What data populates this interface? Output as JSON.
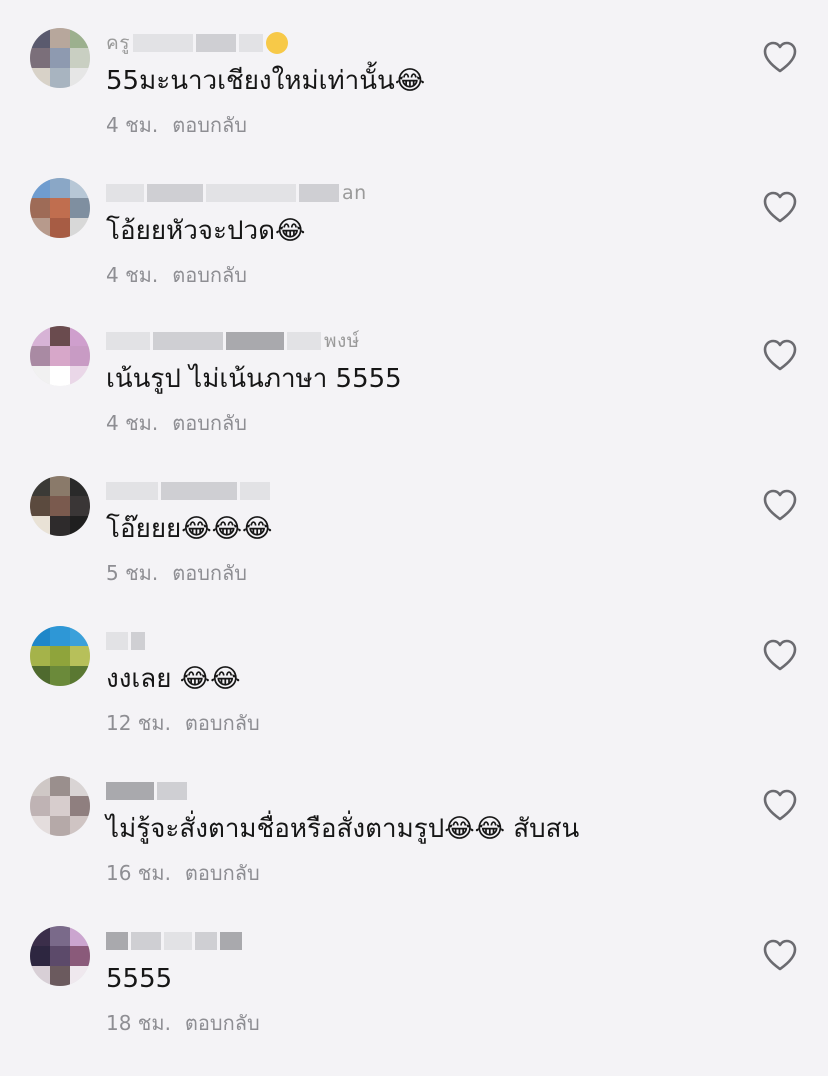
{
  "comments": [
    {
      "username": "ครู",
      "text": "55มะนาวเชียงใหม่เท่านั้น😂",
      "time": "4 ชม.",
      "reply": "ตอบกลับ",
      "avatar_colors": [
        "#5a5a6e",
        "#b7a79c",
        "#9cb08e",
        "#7b6f7a",
        "#8e9ab0",
        "#c9cfc2",
        "#d8d2c8",
        "#a8b4c0",
        "#e6e6e6"
      ]
    },
    {
      "username": "an",
      "text": "โอ้ยยหัวจะปวด😂",
      "time": "4 ชม.",
      "reply": "ตอบกลับ",
      "avatar_colors": [
        "#6f9ccf",
        "#8aa7c6",
        "#b7c7d6",
        "#9e6b57",
        "#c06e4f",
        "#7f8fa0",
        "#b79a8c",
        "#a75c44",
        "#d8d8d8"
      ]
    },
    {
      "username": "พงษ์",
      "text": "เน้นรูป ไม่เน้นภาษา 5555",
      "time": "4 ชม.",
      "reply": "ตอบกลับ",
      "avatar_colors": [
        "#d7b3d6",
        "#6a4b4e",
        "#cf9fcd",
        "#a98aa3",
        "#d7a7c9",
        "#c89bc4",
        "#f1f1f1",
        "#ffffff",
        "#ead7e8"
      ]
    },
    {
      "username": "",
      "text": "โอ๊ยยย😂😂😂",
      "time": "5 ชม.",
      "reply": "ตอบกลับ",
      "avatar_colors": [
        "#3b3a36",
        "#8a7a6a",
        "#2a2a2a",
        "#5b4a3e",
        "#7a5a4e",
        "#3a3636",
        "#e9e2d6",
        "#2e2b2c",
        "#1f1f1f"
      ]
    },
    {
      "username": "",
      "text": "งงเลย 😂😂",
      "time": "12 ชม.",
      "reply": "ตอบกลับ",
      "avatar_colors": [
        "#1f87c9",
        "#2e97d6",
        "#3ba0da",
        "#a5b34a",
        "#8fa43b",
        "#b7c05a",
        "#4f6a2e",
        "#6b8a3a",
        "#5a7832"
      ]
    },
    {
      "username": "",
      "text": "ไม่รู้จะสั่งตามชื่อหรือสั่งตามรูป😂😂 สับสน",
      "time": "16 ชม.",
      "reply": "ตอบกลับ",
      "avatar_colors": [
        "#cfc8c6",
        "#9a8f8d",
        "#d9d4d4",
        "#bfb3b4",
        "#d7cdcd",
        "#8f7f7f",
        "#e4dddd",
        "#b5a9a8",
        "#cfc4c3"
      ]
    },
    {
      "username": "",
      "text": "5555",
      "time": "18 ชม.",
      "reply": "ตอบกลับ",
      "avatar_colors": [
        "#3b2e4a",
        "#7a6a8a",
        "#cba5cf",
        "#2d2640",
        "#5c4a6a",
        "#8a5a7a",
        "#d8cfd6",
        "#6b5a5e",
        "#efe8ee"
      ]
    }
  ],
  "icons": {
    "heart": "heart-outline-icon"
  },
  "colors": {
    "background": "#f4f3f6",
    "text": "#161616",
    "secondary_text": "#8e8e93",
    "heart_stroke": "#6b6b70"
  }
}
